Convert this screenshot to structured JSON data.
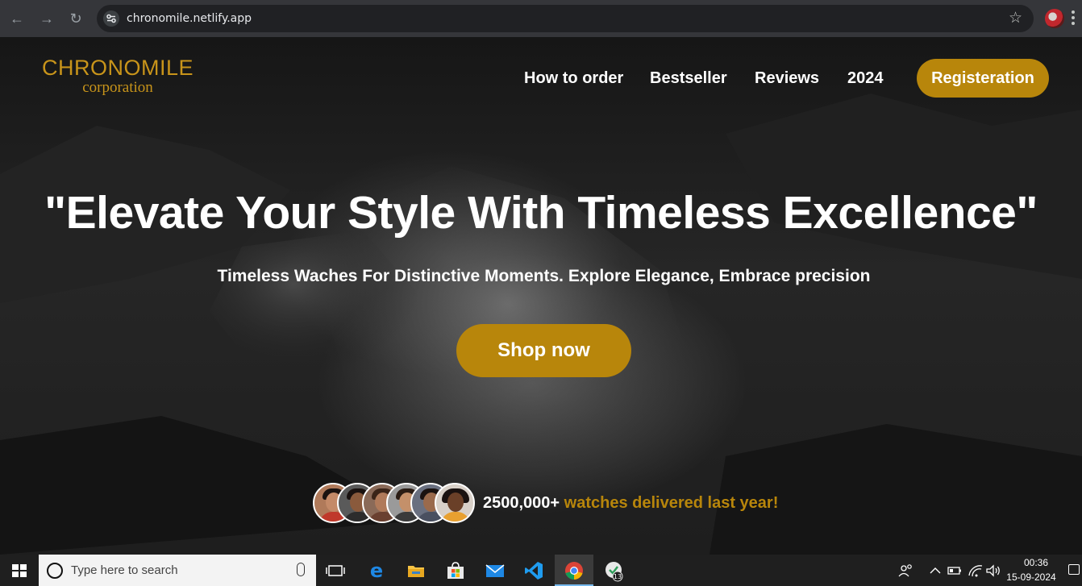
{
  "browser": {
    "url": "chronomile.netlify.app"
  },
  "site": {
    "logo": {
      "title": "CHRONOMILE",
      "subtitle": "corporation"
    },
    "nav": [
      {
        "label": "How to order"
      },
      {
        "label": "Bestseller"
      },
      {
        "label": "Reviews"
      },
      {
        "label": "2024"
      }
    ],
    "register_label": "Registeration",
    "hero_title": "\"Elevate Your Style With Timeless Excellence\"",
    "hero_subtitle": "Timeless Waches For Distinctive Moments. Explore Elegance, Embrace precision",
    "shop_label": "Shop now",
    "stat_number": "2500,000+",
    "stat_text": "watches delivered last year!",
    "accent_color": "#b8860b"
  },
  "taskbar": {
    "search_placeholder": "Type here to search",
    "time": "00:36",
    "date": "15-09-2024",
    "chrome_badge": "13"
  }
}
